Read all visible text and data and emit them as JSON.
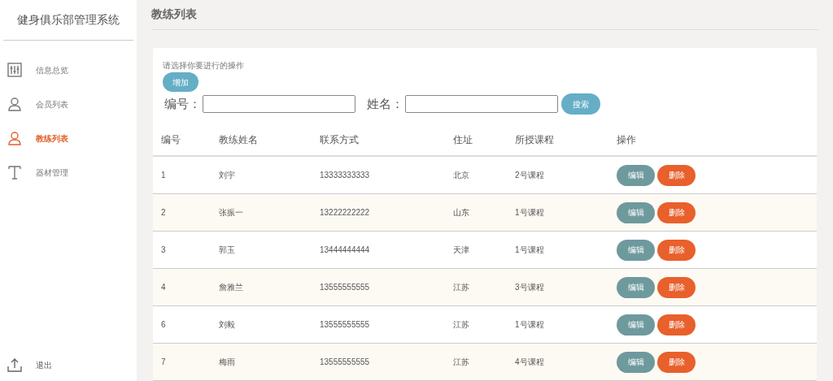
{
  "sidebar": {
    "title": "健身俱乐部管理系统",
    "items": [
      {
        "label": "信息总览",
        "kind": "sliders",
        "selected": false
      },
      {
        "label": "会员列表",
        "kind": "user",
        "selected": false
      },
      {
        "label": "教练列表",
        "kind": "user",
        "selected": true
      },
      {
        "label": "器材管理",
        "kind": "text",
        "selected": false
      }
    ],
    "logout": "退出"
  },
  "page_title": "教练列表",
  "prompt": "请选择你要进行的操作",
  "add_button": "增加",
  "filters": [
    {
      "label": "编号："
    },
    {
      "label": "姓名："
    }
  ],
  "search_button": "搜索",
  "table": {
    "columns": [
      "编号",
      "教练姓名",
      "联系方式",
      "住址",
      "所授课程",
      "操作"
    ],
    "rows": [
      {
        "cells": [
          "1",
          "刘宇",
          "13333333333",
          "北京",
          "2号课程"
        ],
        "actions": [
          {
            "kind": "edit",
            "label": "编辑"
          },
          {
            "kind": "delete",
            "label": "删除"
          }
        ]
      },
      {
        "cells": [
          "2",
          "张振一",
          "13222222222",
          "山东",
          "1号课程"
        ],
        "actions": [
          {
            "kind": "edit",
            "label": "编辑"
          },
          {
            "kind": "delete",
            "label": "删除"
          }
        ]
      },
      {
        "cells": [
          "3",
          "郭玉",
          "13444444444",
          "天津",
          "1号课程"
        ],
        "actions": [
          {
            "kind": "edit",
            "label": "编辑"
          },
          {
            "kind": "delete",
            "label": "删除"
          }
        ]
      },
      {
        "cells": [
          "4",
          "詹雅兰",
          "13555555555",
          "江苏",
          "3号课程"
        ],
        "actions": [
          {
            "kind": "edit",
            "label": "编辑"
          },
          {
            "kind": "delete",
            "label": "删除"
          }
        ]
      },
      {
        "cells": [
          "6",
          "刘毅",
          "13555555555",
          "江苏",
          "1号课程"
        ],
        "actions": [
          {
            "kind": "edit",
            "label": "编辑"
          },
          {
            "kind": "delete",
            "label": "删除"
          }
        ]
      },
      {
        "cells": [
          "7",
          "梅雨",
          "13555555555",
          "江苏",
          "4号课程"
        ],
        "actions": [
          {
            "kind": "edit",
            "label": "编辑"
          },
          {
            "kind": "delete",
            "label": "删除"
          }
        ]
      }
    ]
  }
}
